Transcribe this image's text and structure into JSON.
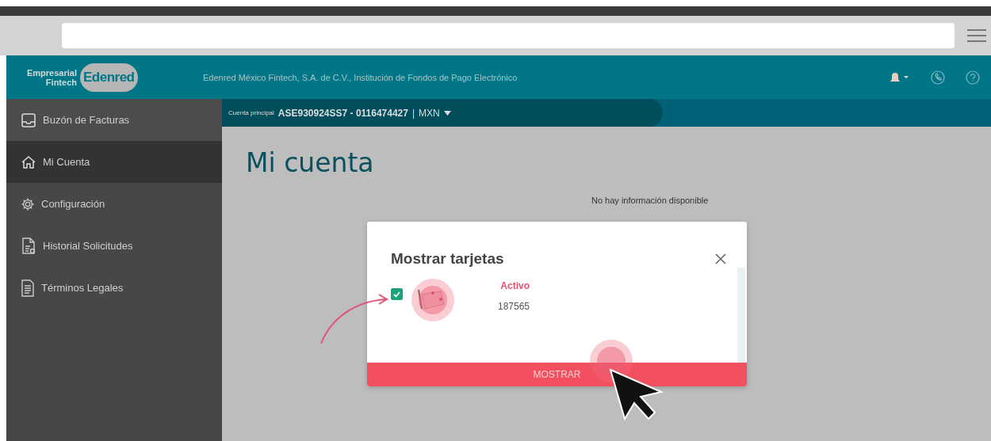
{
  "header": {
    "logo": {
      "line1": "Empresarial",
      "line2": "Fintech",
      "brand": "Edenred"
    },
    "company": "Edenred México Fintech, S.A. de C.V., Institución de Fondos de Pago Electrónico"
  },
  "sidebar": {
    "items": [
      {
        "label": "Buzón de Facturas",
        "kind": "inbox",
        "selected": false
      },
      {
        "label": "Mi Cuenta",
        "kind": "home",
        "selected": true
      },
      {
        "label": "Configuración",
        "kind": "settings",
        "selected": false
      },
      {
        "label": "Historial Solicitudes",
        "kind": "history",
        "selected": false
      },
      {
        "label": "Términos Legales",
        "kind": "legal",
        "selected": false
      }
    ]
  },
  "account_bar": {
    "label": "Cuenta principal",
    "account": "ASE930924SS7 - 0116474427",
    "separator": "|",
    "currency": "MXN"
  },
  "main": {
    "title": "Mi cuenta",
    "empty_message": "No hay información disponible"
  },
  "modal": {
    "title": "Mostrar tarjetas",
    "cards": [
      {
        "status": "Activo",
        "number": "187565",
        "checked": true
      }
    ],
    "button": "MOSTRAR"
  }
}
